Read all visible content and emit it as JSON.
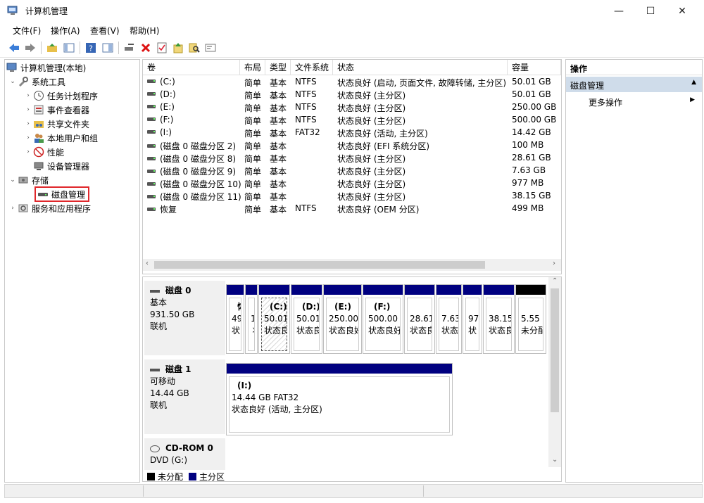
{
  "window": {
    "title": "计算机管理",
    "minimize": "—",
    "maximize": "☐",
    "close": "✕"
  },
  "menu": [
    "文件(F)",
    "操作(A)",
    "查看(V)",
    "帮助(H)"
  ],
  "tree": {
    "root": "计算机管理(本地)",
    "system_tools": "系统工具",
    "task_scheduler": "任务计划程序",
    "event_viewer": "事件查看器",
    "shared_folders": "共享文件夹",
    "local_users": "本地用户和组",
    "performance": "性能",
    "device_manager": "设备管理器",
    "storage": "存储",
    "disk_management": "磁盘管理",
    "services_apps": "服务和应用程序"
  },
  "volumes": {
    "headers": [
      "卷",
      "布局",
      "类型",
      "文件系统",
      "状态",
      "容量"
    ],
    "rows": [
      [
        "(C:)",
        "简单",
        "基本",
        "NTFS",
        "状态良好 (启动, 页面文件, 故障转储, 主分区)",
        "50.01 GB"
      ],
      [
        "(D:)",
        "简单",
        "基本",
        "NTFS",
        "状态良好 (主分区)",
        "50.01 GB"
      ],
      [
        "(E:)",
        "简单",
        "基本",
        "NTFS",
        "状态良好 (主分区)",
        "250.00 GB"
      ],
      [
        "(F:)",
        "简单",
        "基本",
        "NTFS",
        "状态良好 (主分区)",
        "500.00 GB"
      ],
      [
        "(I:)",
        "简单",
        "基本",
        "FAT32",
        "状态良好 (活动, 主分区)",
        "14.42 GB"
      ],
      [
        "(磁盘 0 磁盘分区 2)",
        "简单",
        "基本",
        "",
        "状态良好 (EFI 系统分区)",
        "100 MB"
      ],
      [
        "(磁盘 0 磁盘分区 8)",
        "简单",
        "基本",
        "",
        "状态良好 (主分区)",
        "28.61 GB"
      ],
      [
        "(磁盘 0 磁盘分区 9)",
        "简单",
        "基本",
        "",
        "状态良好 (主分区)",
        "7.63 GB"
      ],
      [
        "(磁盘 0 磁盘分区 10)",
        "简单",
        "基本",
        "",
        "状态良好 (主分区)",
        "977 MB"
      ],
      [
        "(磁盘 0 磁盘分区 11)",
        "简单",
        "基本",
        "",
        "状态良好 (主分区)",
        "38.15 GB"
      ],
      [
        "恢复",
        "简单",
        "基本",
        "NTFS",
        "状态良好 (OEM 分区)",
        "499 MB"
      ]
    ]
  },
  "disk0": {
    "name": "磁盘 0",
    "type": "基本",
    "size": "931.50 GB",
    "status": "联机",
    "partitions": [
      {
        "l1": "恢",
        "l2": "49",
        "l3": "状"
      },
      {
        "l1": "",
        "l2": "1",
        "l3": "丬"
      },
      {
        "l1": "(C:)",
        "l2": "50.01",
        "l3": "状态良"
      },
      {
        "l1": "(D:)",
        "l2": "50.01",
        "l3": "状态良"
      },
      {
        "l1": "(E:)",
        "l2": "250.00",
        "l3": "状态良好"
      },
      {
        "l1": "(F:)",
        "l2": "500.00",
        "l3": "状态良好"
      },
      {
        "l1": "",
        "l2": "28.61",
        "l3": "状态良"
      },
      {
        "l1": "",
        "l2": "7.63",
        "l3": "状态"
      },
      {
        "l1": "",
        "l2": "97",
        "l3": "状"
      },
      {
        "l1": "",
        "l2": "38.15",
        "l3": "状态良"
      },
      {
        "l1": "",
        "l2": "5.55",
        "l3": "未分配"
      }
    ]
  },
  "disk1": {
    "name": "磁盘 1",
    "type": "可移动",
    "size": "14.44 GB",
    "status": "联机",
    "partition": {
      "l1": "(I:)",
      "l2": "14.44 GB FAT32",
      "l3": "状态良好 (活动, 主分区)"
    }
  },
  "cdrom": {
    "name": "CD-ROM 0",
    "drive": "DVD (G:)"
  },
  "legend": {
    "unallocated": "未分配",
    "primary": "主分区",
    "unalloc_color": "#000000",
    "primary_color": "#000080"
  },
  "actions": {
    "header": "操作",
    "section": "磁盘管理",
    "more": "更多操作"
  }
}
